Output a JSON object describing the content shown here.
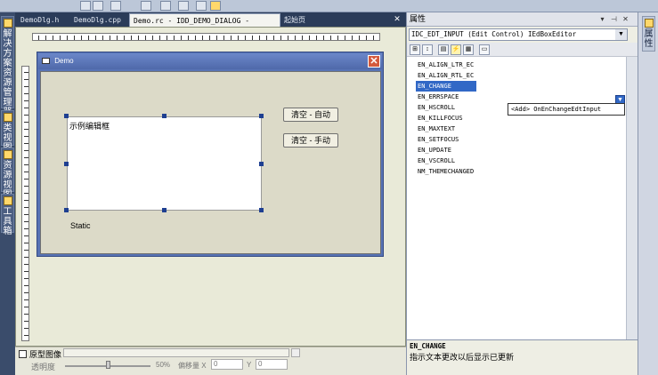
{
  "doc_tabs": [
    {
      "label": "DemoDlg.h"
    },
    {
      "label": "DemoDlg.cpp"
    },
    {
      "label": "Demo.rc - IDD_DEMO_DIALOG - Dialog*",
      "active": true
    },
    {
      "label": "起始页"
    }
  ],
  "left_strip": [
    {
      "label": "解决方案资源管理器",
      "icon": "solution-explorer-icon"
    },
    {
      "label": "类视图",
      "icon": "class-view-icon"
    },
    {
      "label": "资源视图",
      "icon": "resource-view-icon"
    },
    {
      "label": "工具箱",
      "icon": "toolbox-icon"
    }
  ],
  "dialog": {
    "title": "Demo",
    "close_glyph": "✕",
    "edit_text": "示例编辑框",
    "btn_auto": "清空 - 自动",
    "btn_manual": "清空 - 手动",
    "static_label": "Static"
  },
  "protobar": {
    "prototype_label": "原型图像",
    "opacity_label": "透明度",
    "opacity_value": "50%",
    "offset_label": "偏移量 X",
    "x_value": "0",
    "y_label": "Y",
    "y_value": "0"
  },
  "properties": {
    "title": "属性",
    "object_select": "IDC_EDT_INPUT (Edit Control) IEdBoxEditor",
    "events": [
      "EN_ALIGN_LTR_EC",
      "EN_ALIGN_RTL_EC",
      "EN_CHANGE",
      "EN_ERRSPACE",
      "EN_HSCROLL",
      "EN_KILLFOCUS",
      "EN_MAXTEXT",
      "EN_SETFOCUS",
      "EN_UPDATE",
      "EN_VSCROLL",
      "NM_THEMECHANGED"
    ],
    "selected_index": 2,
    "dropdown_option": "<Add> OnEnChangeEdtInput",
    "desc_title": "EN_CHANGE",
    "desc_text": "指示文本更改以后显示已更新"
  },
  "right_strip": {
    "label": "属性"
  },
  "colors": {
    "selection": "#3168c6",
    "dialog_caption": "#5773b5",
    "close_button": "#d45a3c"
  }
}
